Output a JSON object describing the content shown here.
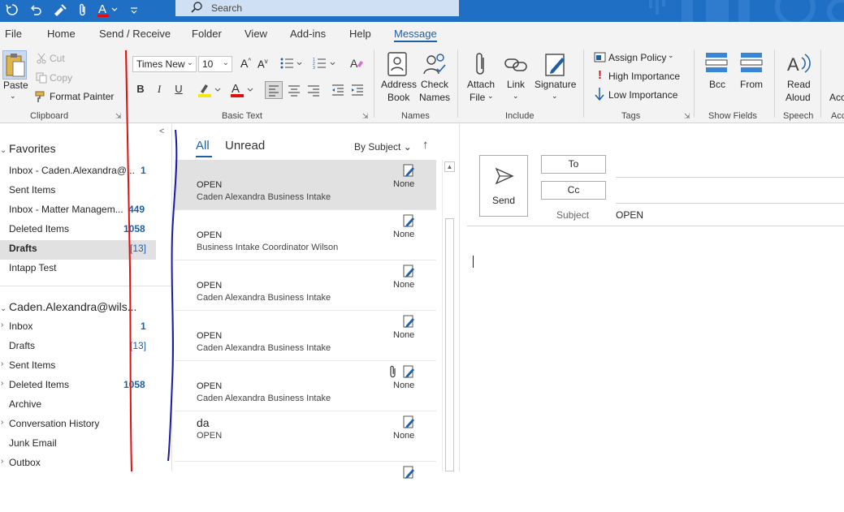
{
  "search": {
    "placeholder": "Search"
  },
  "menu": {
    "items": [
      "File",
      "Home",
      "Send / Receive",
      "Folder",
      "View",
      "Add-ins",
      "Help",
      "Message"
    ],
    "active": "Message"
  },
  "ribbon": {
    "clipboard": {
      "paste": "Paste",
      "cut": "Cut",
      "copy": "Copy",
      "format_painter": "Format Painter",
      "group": "Clipboard"
    },
    "basic_text": {
      "font": "Times New",
      "size": "10",
      "bold": "B",
      "italic": "I",
      "underline": "U",
      "group": "Basic Text"
    },
    "names": {
      "address_book_1": "Address",
      "address_book_2": "Book",
      "check_names_1": "Check",
      "check_names_2": "Names",
      "group": "Names"
    },
    "include": {
      "attach_1": "Attach",
      "attach_2": "File",
      "link": "Link",
      "signature": "Signature",
      "group": "Include"
    },
    "tags": {
      "assign_policy": "Assign Policy",
      "high_importance": "High Importance",
      "low_importance": "Low Importance",
      "group": "Tags"
    },
    "show_fields": {
      "bcc": "Bcc",
      "from": "From",
      "group": "Show Fields"
    },
    "speech": {
      "read_aloud_1": "Read",
      "read_aloud_2": "Aloud",
      "group": "Speech"
    },
    "cut_off": {
      "label_1": "Acc",
      "label_2": "Acc"
    }
  },
  "nav": {
    "favorites": "Favorites",
    "fav_items": [
      {
        "label": "Inbox - Caden.Alexandra@...",
        "count": "1"
      },
      {
        "label": "Sent Items",
        "count": ""
      },
      {
        "label": "Inbox - Matter Managem...",
        "count": "449"
      },
      {
        "label": "Deleted Items",
        "count": "1058"
      },
      {
        "label": "Drafts",
        "count": "[13]"
      },
      {
        "label": "Intapp Test",
        "count": ""
      }
    ],
    "account": "Caden.Alexandra@wils...",
    "acct_items": [
      {
        "label": "Inbox",
        "count": "1"
      },
      {
        "label": "Drafts",
        "count": "[13]"
      },
      {
        "label": "Sent Items",
        "count": ""
      },
      {
        "label": "Deleted Items",
        "count": "1058"
      },
      {
        "label": "Archive",
        "count": ""
      },
      {
        "label": "Conversation History",
        "count": ""
      },
      {
        "label": "Junk Email",
        "count": ""
      },
      {
        "label": "Outbox",
        "count": ""
      }
    ]
  },
  "list": {
    "tab_all": "All",
    "tab_unread": "Unread",
    "sort": "By Subject",
    "messages": [
      {
        "line1": "OPEN",
        "line2": "Caden Alexandra  Business Intake",
        "category": "None"
      },
      {
        "line1": "OPEN",
        "line2": "Business Intake Coordinator  Wilson",
        "category": "None"
      },
      {
        "line1": "OPEN",
        "line2": "Caden Alexandra  Business Intake",
        "category": "None"
      },
      {
        "line1": "OPEN",
        "line2": "Caden Alexandra  Business Intake",
        "category": "None"
      },
      {
        "line1": "OPEN",
        "line2": "Caden Alexandra  Business Intake",
        "category": "None"
      },
      {
        "line1": "da",
        "line2": "OPEN",
        "category": "None"
      }
    ]
  },
  "compose": {
    "send": "Send",
    "to": "To",
    "cc": "Cc",
    "subject_label": "Subject",
    "subject_value": "OPEN"
  },
  "colors": {
    "titlebar": "#1f6fc4",
    "accent": "#1f5fa8",
    "count_blue": "#1f5fa8",
    "ink_red": "#e01010",
    "ink_blue": "#1a1aa8"
  }
}
